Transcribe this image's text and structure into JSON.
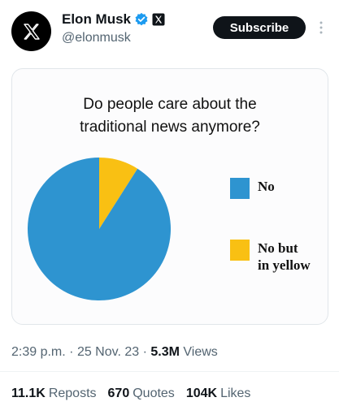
{
  "header": {
    "display_name": "Elon Musk",
    "handle": "@elonmusk",
    "subscribe_label": "Subscribe",
    "avatar_icon": "x-logo-icon",
    "verified_icon": "verified-badge-icon",
    "affiliate_icon": "x-affiliate-icon",
    "more_icon": "more-vertical-icon",
    "verified_color": "#1d9bf0"
  },
  "media": {
    "title": "Do people care about the\ntraditional news anymore?"
  },
  "chart_data": {
    "type": "pie",
    "title": "Do people care about the\ntraditional news anymore?",
    "slices": [
      {
        "label": "No",
        "value": 91,
        "color": "#2e94d0"
      },
      {
        "label": "No but\nin yellow",
        "value": 9,
        "color": "#f9c013"
      }
    ],
    "legend_placement": "right"
  },
  "meta": {
    "time": "2:39 p.m.",
    "date": "25 Nov. 23",
    "separator": "·",
    "views_count": "5.3M",
    "views_label": "Views"
  },
  "stats": {
    "reposts_count": "11.1K",
    "reposts_label": "Reposts",
    "quotes_count": "670",
    "quotes_label": "Quotes",
    "likes_count": "104K",
    "likes_label": "Likes"
  }
}
